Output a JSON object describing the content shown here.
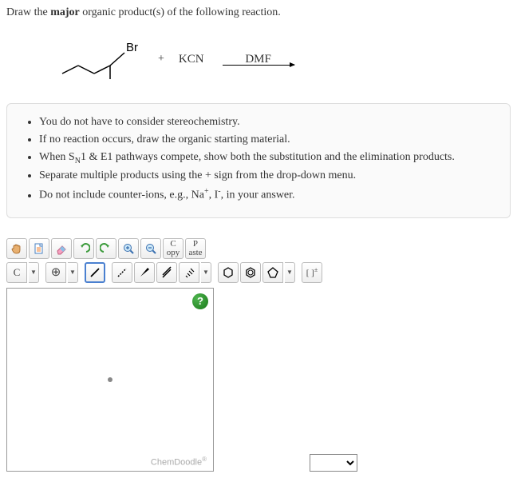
{
  "question": {
    "prefix": "Draw the ",
    "bold": "major",
    "suffix": " organic product(s) of the following reaction."
  },
  "reaction": {
    "substituent": "Br",
    "plus": "+",
    "reagent": "KCN",
    "solvent": "DMF"
  },
  "hints": [
    "You do not have to consider stereochemistry.",
    "If no reaction occurs, draw the organic starting material.",
    "When S_N1 & E1 pathways compete, show both the substitution and the elimination products.",
    "Separate multiple products using the + sign from the drop-down menu.",
    "Do not include counter-ions, e.g., Na^+, I^-, in your answer."
  ],
  "toolbar": {
    "row1": {
      "hand": "✋",
      "document": "📄",
      "eraser": "eraser",
      "undo": "↶",
      "redo": "↷",
      "zoom_in": "+",
      "zoom_out": "−",
      "copy_top": "C",
      "copy_bot": "opy",
      "paste_top": "P",
      "paste_bot": "aste"
    },
    "row2": {
      "element": "C",
      "add": "⊕",
      "solid": "solid",
      "dashed": "dashed",
      "bold": "bold",
      "double": "double",
      "hash": "hash",
      "hex": "hex",
      "benz": "benz",
      "pent": "pent",
      "charge": "[ ]±"
    }
  },
  "canvas": {
    "help": "?",
    "brand": "ChemDoodle",
    "reg": "®"
  }
}
